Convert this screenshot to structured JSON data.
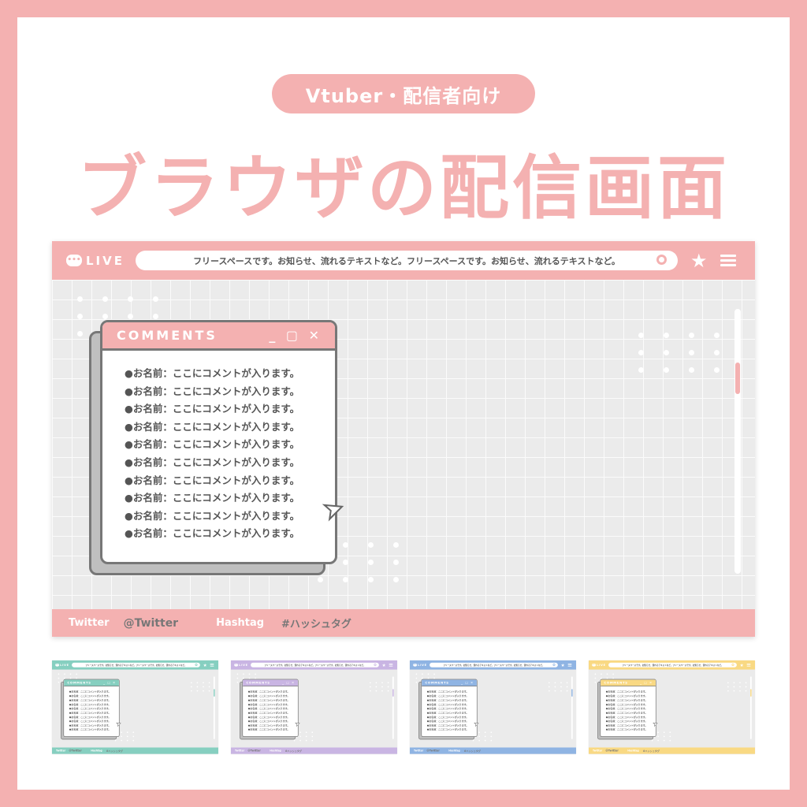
{
  "header": {
    "badge": "Vtuber・配信者向け",
    "title": "ブラウザの配信画面"
  },
  "browser": {
    "live_label": "LIVE",
    "live_icon": "chat-bubble-icon",
    "url_text": "フリースペースです。お知らせ、流れるテキストなど。フリースペースです。お知らせ、流れるテキストなど。",
    "icons": [
      "search-icon",
      "star-icon",
      "menu-icon"
    ],
    "window_title": "COMMENTS",
    "window_controls": "_ ▢ ✕",
    "comments": [
      "●お名前：ここにコメントが入ります。",
      "●お名前：ここにコメントが入ります。",
      "●お名前：ここにコメントが入ります。",
      "●お名前：ここにコメントが入ります。",
      "●お名前：ここにコメントが入ります。",
      "●お名前：ここにコメントが入ります。",
      "●お名前：ここにコメントが入ります。",
      "●お名前：ここにコメントが入ります。",
      "●お名前：ここにコメントが入ります。",
      "●お名前：ここにコメントが入ります。"
    ],
    "footer": {
      "twitter_label": "Twitter",
      "twitter_handle": "@Twitter",
      "hashtag_label": "Hashtag",
      "hashtag_value": "#ハッシュタグ"
    }
  },
  "colors": {
    "main": "#f4b1b1",
    "variants": [
      "#86cfc0",
      "#c9b5e3",
      "#8fb4e3",
      "#f9d983"
    ]
  }
}
